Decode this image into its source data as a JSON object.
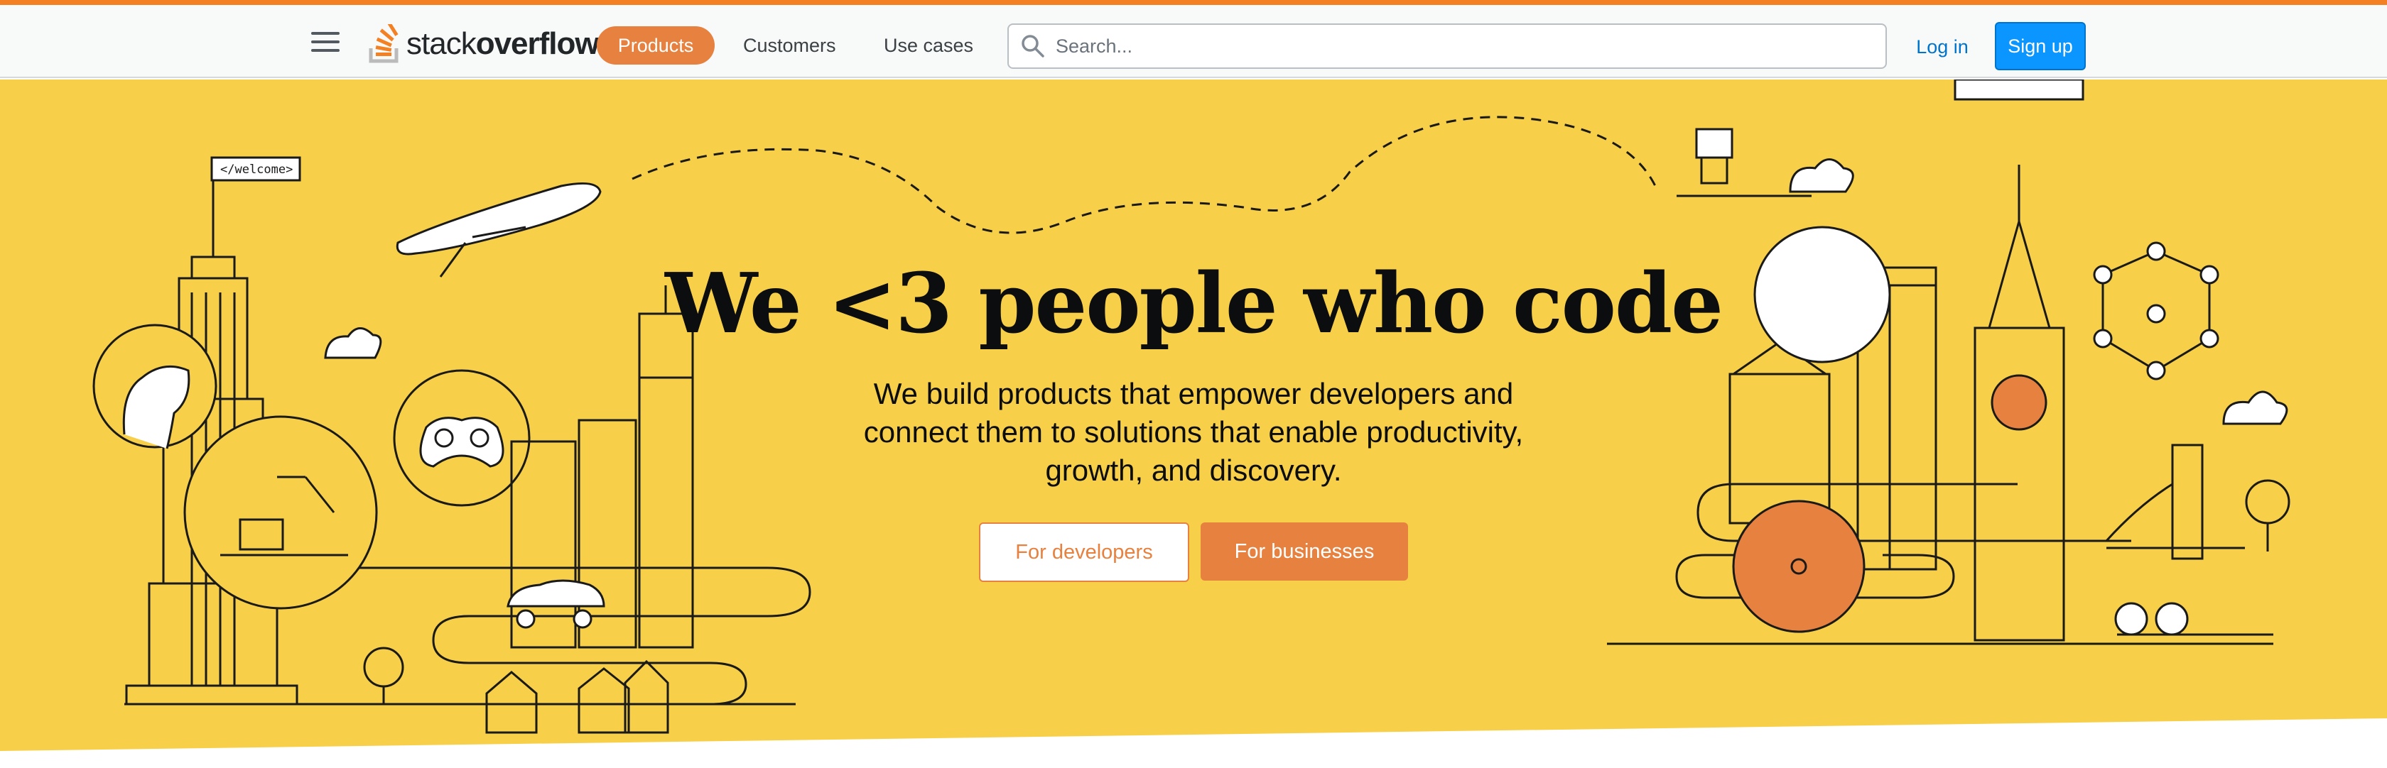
{
  "header": {
    "menu_icon": "hamburger-icon",
    "logo": {
      "text_regular": "stack",
      "text_bold": "overflow",
      "icon": "stack-overflow-logo-icon"
    },
    "nav": [
      "Products",
      "Customers",
      "Use cases"
    ],
    "search": {
      "placeholder": "Search...",
      "value": ""
    },
    "login_label": "Log in",
    "signup_label": "Sign up"
  },
  "hero": {
    "title": "We <3 people who code",
    "subtitle": "We build products that empower developers and connect them to solutions that enable productivity, growth, and discovery.",
    "button_developers": "For developers",
    "button_businesses": "For businesses",
    "flag_text": "</welcome>"
  },
  "colors": {
    "accent_orange": "#e7813f",
    "hero_yellow": "#f7cf48",
    "signup_blue": "#0a95ff",
    "link_blue": "#0074cc"
  }
}
